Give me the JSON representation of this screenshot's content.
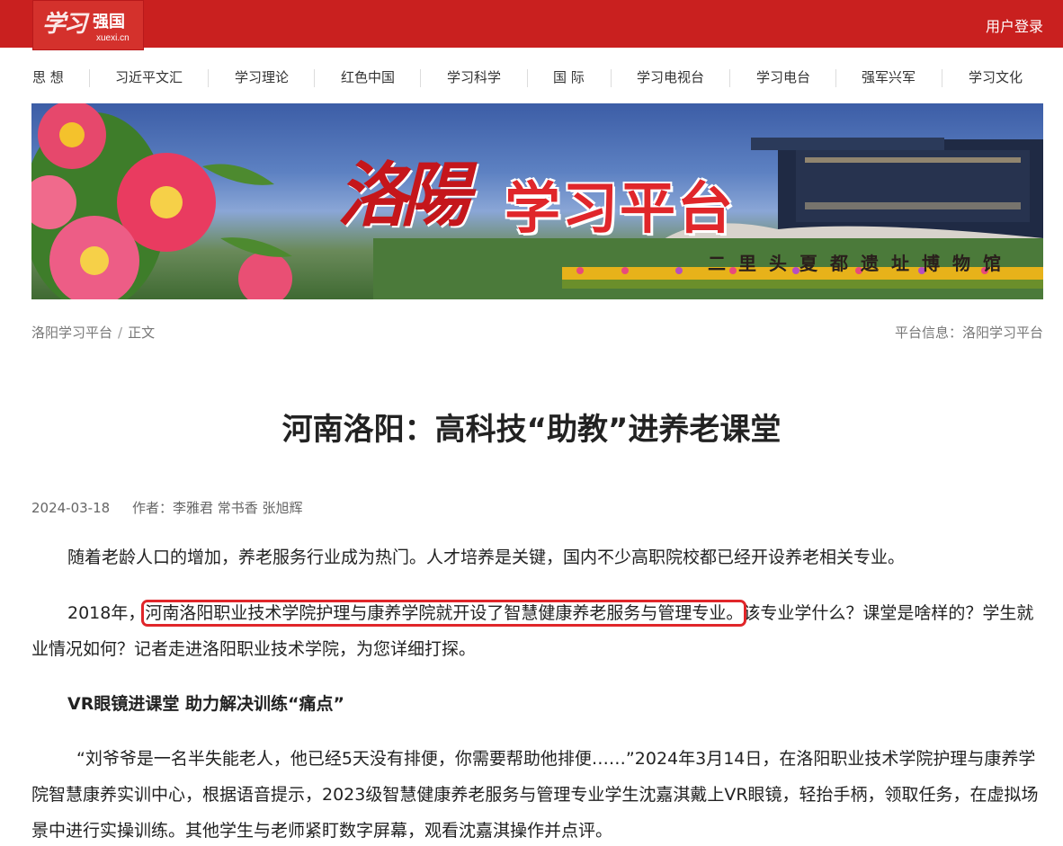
{
  "header": {
    "logo_script": "学习",
    "logo_brand": "强国",
    "logo_domain": "xuexi.cn",
    "login_label": "用户登录"
  },
  "nav": {
    "items": [
      "思 想",
      "习近平文汇",
      "学习理论",
      "红色中国",
      "学习科学",
      "国 际",
      "学习电视台",
      "学习电台",
      "强军兴军",
      "学习文化"
    ]
  },
  "banner": {
    "calligraphy": "洛陽",
    "title": "学习平台",
    "museum": "二里头夏都遗址博物馆"
  },
  "breadcrumb": {
    "home": "洛阳学习平台",
    "separator": "/",
    "current": "正文",
    "platform_info": "平台信息：洛阳学习平台"
  },
  "article": {
    "title": "河南洛阳：高科技“助教”进养老课堂",
    "date": "2024-03-18",
    "author": "作者：李雅君 常书香 张旭辉",
    "p1": "随着老龄人口的增加，养老服务行业成为热门。人才培养是关键，国内不少高职院校都已经开设养老相关专业。",
    "p2_pre": "2018年，",
    "p2_highlight": "河南洛阳职业技术学院护理与康养学院就开设了智慧健康养老服务与管理专业。",
    "p2_post": "该专业学什么？课堂是啥样的？学生就业情况如何？记者走进洛阳职业技术学院，为您详细打探。",
    "subhead": "VR眼镜进课堂 助力解决训练“痛点”",
    "p3": "“刘爷爷是一名半失能老人，他已经5天没有排便，你需要帮助他排便……”2024年3月14日，在洛阳职业技术学院护理与康养学院智慧康养实训中心，根据语音提示，2023级智慧健康养老服务与管理专业学生沈嘉淇戴上VR眼镜，轻抬手柄，领取任务，在虚拟场景中进行实操训练。其他学生与老师紧盯数字屏幕，观看沈嘉淇操作并点评。"
  },
  "colors": {
    "brand_red": "#c9201f",
    "highlight_red": "#e0262a"
  }
}
